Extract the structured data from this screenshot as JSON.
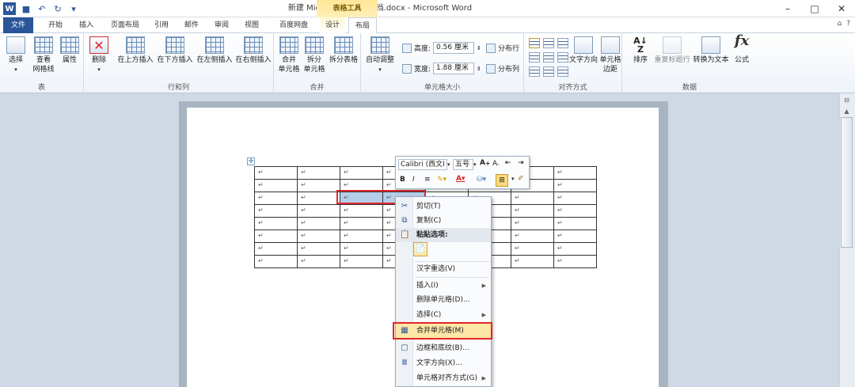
{
  "window": {
    "title": "新建 Microsoft Word 文档.docx - Microsoft Word",
    "contextual_tab_group": "表格工具",
    "controls": [
      "–",
      "□",
      "✕"
    ]
  },
  "tabs": [
    "文件",
    "开始",
    "插入",
    "页面布局",
    "引用",
    "邮件",
    "审阅",
    "视图",
    "百度网盘",
    "设计",
    "布局"
  ],
  "ribbon": {
    "groups": [
      {
        "label": "表",
        "buttons": [
          "选择",
          "查看网格线",
          "属性"
        ]
      },
      {
        "label": "行和列",
        "buttons": [
          "删除",
          "在上方插入",
          "在下方插入",
          "在左侧插入",
          "在右侧插入"
        ]
      },
      {
        "label": "合并",
        "buttons": [
          "合并单元格",
          "拆分单元格",
          "拆分表格"
        ]
      },
      {
        "label": "单元格大小",
        "autofit": "自动调整",
        "height_label": "高度:",
        "height_value": "0.56 厘米",
        "width_label": "宽度:",
        "width_value": "1.88 厘米",
        "dist_rows": "分布行",
        "dist_cols": "分布列"
      },
      {
        "label": "对齐方式",
        "buttons": [
          "文字方向",
          "单元格边距"
        ]
      },
      {
        "label": "数据",
        "buttons": [
          "排序",
          "重复标题行",
          "转换为文本",
          "公式"
        ]
      }
    ],
    "select_line1": "选择",
    "gridlines_line1": "查看",
    "gridlines_line2": "网格线",
    "props": "属性",
    "delete": "删除",
    "ins_above": "在上方插入",
    "ins_below": "在下方插入",
    "ins_left": "在左侧插入",
    "ins_right": "在右侧插入",
    "merge_l1": "合并",
    "merge_l2": "单元格",
    "split_l1": "拆分",
    "split_l2": "单元格",
    "split_table": "拆分表格",
    "text_dir": "文字方向",
    "cell_margin_l1": "单元格",
    "cell_margin_l2": "边距",
    "sort": "排序",
    "repeat_header": "重复标题行",
    "to_text": "转换为文本",
    "formula": "公式"
  },
  "minibar": {
    "font": "Calibri (西文Ⅰ",
    "size": "五号",
    "buttons": [
      "B",
      "I",
      "≡"
    ]
  },
  "table": {
    "rows": 8,
    "cols": 8,
    "cell_mark": "↵",
    "selected_cells": [
      [
        2,
        2
      ],
      [
        2,
        3
      ]
    ]
  },
  "context_menu": {
    "items": [
      {
        "label": "剪切(T)",
        "icon": "scissors-icon"
      },
      {
        "label": "复制(C)",
        "icon": "copy-icon"
      },
      {
        "label": "粘贴选项:",
        "icon": "paste-icon",
        "header": true
      },
      {
        "label": "汉字重选(V)"
      },
      {
        "label": "插入(I)",
        "submenu": true
      },
      {
        "label": "删除单元格(D)..."
      },
      {
        "label": "选择(C)",
        "submenu": true
      },
      {
        "label": "合并单元格(M)",
        "icon": "merge-cells-icon",
        "highlighted": true
      },
      {
        "label": "边框和底纹(B)...",
        "icon": "borders-icon"
      },
      {
        "label": "文字方向(X)...",
        "icon": "text-direction-icon"
      },
      {
        "label": "单元格对齐方式(G)",
        "submenu": true
      }
    ]
  }
}
